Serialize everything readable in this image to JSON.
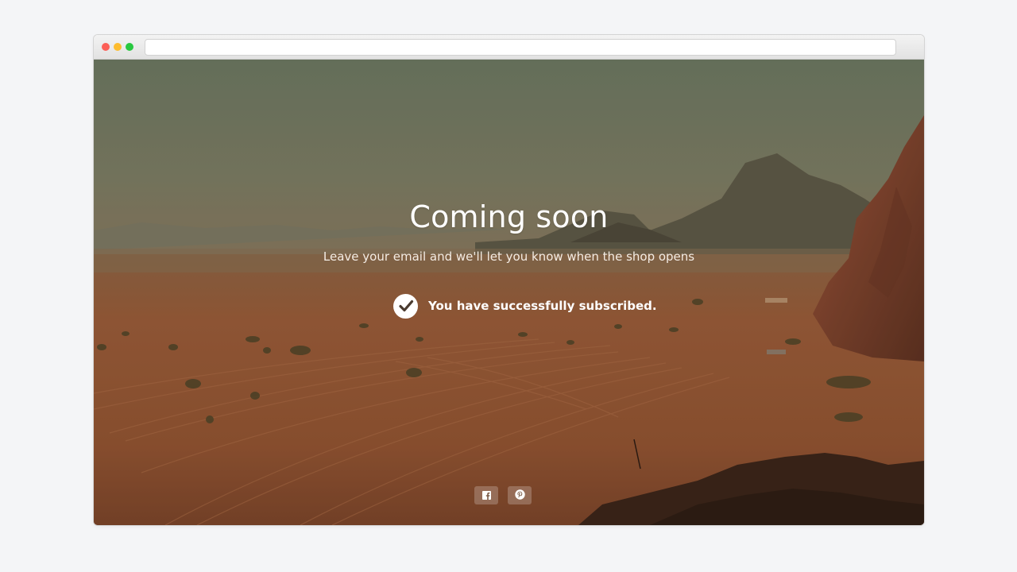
{
  "page": {
    "title": "Coming soon",
    "subtitle": "Leave your email and we'll let you know when the shop opens",
    "success_message": "You have successfully subscribed."
  },
  "browser": {
    "url": ""
  },
  "social": {
    "items": [
      {
        "name": "facebook",
        "icon": "facebook-icon"
      },
      {
        "name": "pinterest",
        "icon": "pinterest-icon"
      }
    ]
  },
  "colors": {
    "text": "#ffffff",
    "page_background": "#f4f5f7",
    "close_dot": "#fc5f57",
    "minimize_dot": "#fdbc2e",
    "zoom_dot": "#28c840"
  }
}
